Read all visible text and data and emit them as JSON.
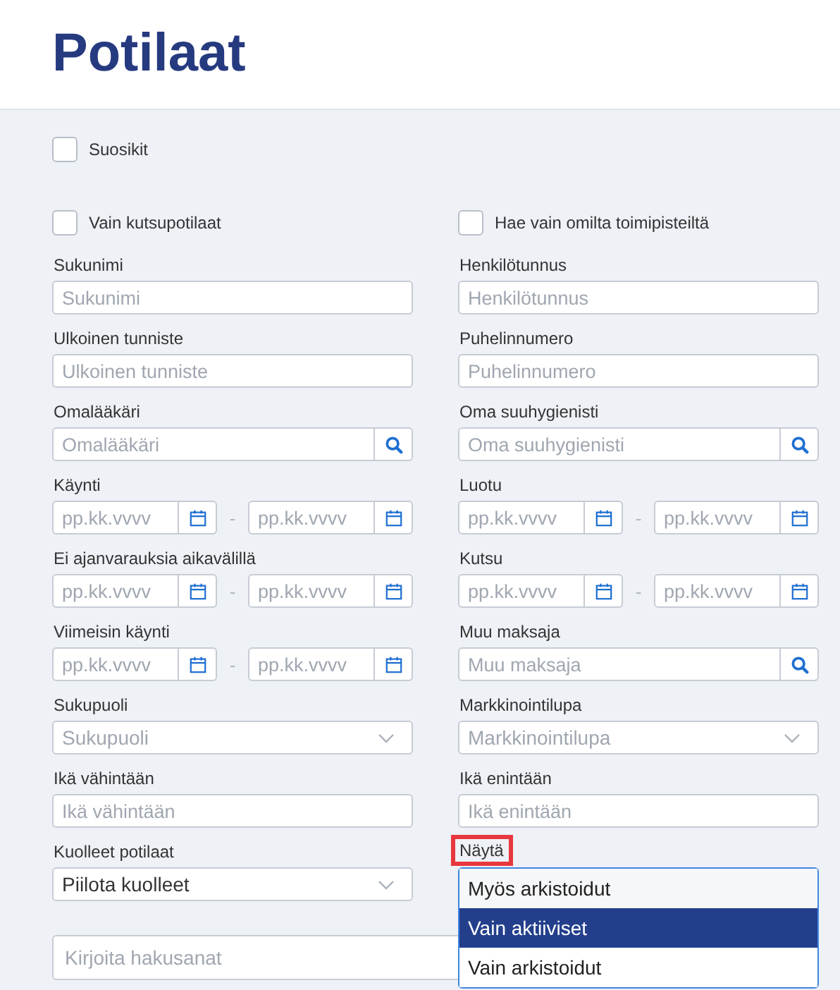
{
  "page_title": "Potilaat",
  "favorites": {
    "label": "Suosikit",
    "checked": false
  },
  "fields": [
    {
      "kind": "checkbox",
      "label": "Vain kutsupotilaat",
      "checked": false
    },
    {
      "kind": "checkbox",
      "label": "Hae vain omilta toimipisteiltä",
      "checked": false
    },
    {
      "kind": "text",
      "label": "Sukunimi",
      "placeholder": "Sukunimi"
    },
    {
      "kind": "text",
      "label": "Henkilötunnus",
      "placeholder": "Henkilötunnus"
    },
    {
      "kind": "text",
      "label": "Ulkoinen tunniste",
      "placeholder": "Ulkoinen tunniste"
    },
    {
      "kind": "text",
      "label": "Puhelinnumero",
      "placeholder": "Puhelinnumero"
    },
    {
      "kind": "search",
      "label": "Omalääkäri",
      "placeholder": "Omalääkäri"
    },
    {
      "kind": "search",
      "label": "Oma suuhygienisti",
      "placeholder": "Oma suuhygienisti"
    },
    {
      "kind": "daterange",
      "label": "Käynti",
      "from_placeholder": "pp.kk.vvvv",
      "separator": "-",
      "to_placeholder": "pp.kk.vvvv"
    },
    {
      "kind": "daterange",
      "label": "Luotu",
      "from_placeholder": "pp.kk.vvvv",
      "separator": "-",
      "to_placeholder": "pp.kk.vvvv"
    },
    {
      "kind": "daterange",
      "label": "Ei ajanvarauksia aikavälillä",
      "from_placeholder": "pp.kk.vvvv",
      "separator": "-",
      "to_placeholder": "pp.kk.vvvv"
    },
    {
      "kind": "daterange",
      "label": "Kutsu",
      "from_placeholder": "pp.kk.vvvv",
      "separator": "-",
      "to_placeholder": "pp.kk.vvvv"
    },
    {
      "kind": "daterange",
      "label": "Viimeisin käynti",
      "from_placeholder": "pp.kk.vvvv",
      "separator": "-",
      "to_placeholder": "pp.kk.vvvv"
    },
    {
      "kind": "search",
      "label": "Muu maksaja",
      "placeholder": "Muu maksaja"
    },
    {
      "kind": "select",
      "label": "Sukupuoli",
      "placeholder": "Sukupuoli"
    },
    {
      "kind": "select",
      "label": "Markkinointilupa",
      "placeholder": "Markkinointilupa"
    },
    {
      "kind": "text",
      "label": "Ikä vähintään",
      "placeholder": "Ikä vähintään"
    },
    {
      "kind": "text",
      "label": "Ikä enintään",
      "placeholder": "Ikä enintään"
    },
    {
      "kind": "select",
      "label": "Kuolleet potilaat",
      "value": "Piilota kuolleet"
    },
    {
      "kind": "openselect",
      "label": "Näytä",
      "highlighted": true,
      "options": [
        {
          "label": "Myös arkistoidut",
          "selected": false
        },
        {
          "label": "Vain aktiiviset",
          "selected": true
        },
        {
          "label": "Vain arkistoidut",
          "selected": false
        }
      ]
    }
  ],
  "search": {
    "placeholder": "Kirjoita hakusanat"
  }
}
